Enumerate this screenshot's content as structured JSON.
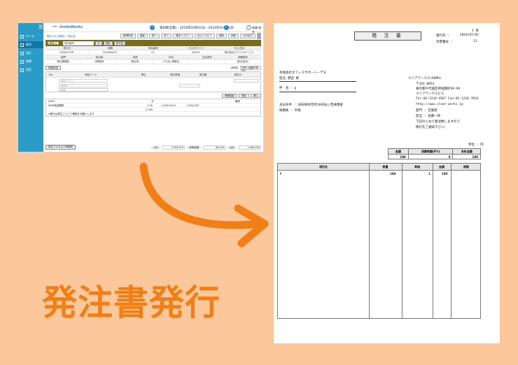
{
  "app": {
    "sidebar": {
      "items": [
        {
          "label": "ホーム",
          "icon": "home-icon"
        },
        {
          "label": "販売",
          "icon": "cart-icon"
        },
        {
          "label": "会計",
          "icon": "ledger-icon"
        },
        {
          "label": "帳簿",
          "icon": "book-icon"
        },
        {
          "label": "設定",
          "icon": "gear-icon"
        }
      ]
    },
    "topbar": {
      "logo_text": "SmileWorks",
      "period": "第8期(営業) : 2018年04月01日 - 2019年03月31日",
      "user_name": "後藤 麻衣",
      "user_button": "▼"
    },
    "breadcrumb": "販売 (仕入管理) > 発注書",
    "toolbar": [
      "新規作成",
      "複製",
      "前へ",
      "次へ",
      "発注へコピー",
      "仕入へコピー",
      "削除",
      "印刷",
      "CSV出力"
    ],
    "title": "発注書編",
    "order_no_placeholder": "発注番号",
    "order_buttons": [
      "ID",
      "検索",
      "新作成"
    ],
    "header_labels": [
      "発注日",
      "納期",
      "発注番号",
      "仕入先コード",
      "仕入先名"
    ],
    "header_values": [
      "2018/07/26",
      "2018/08/20",
      "01",
      "wh101",
      "株式会社スマイルサービス"
    ],
    "sub_labels": [
      "部門",
      "担当者",
      "状態",
      "件名",
      "支払条件",
      "納期条件"
    ],
    "sub_values": [
      "発注業務部",
      "小野裕司",
      "発注済",
      "うちまい様受注",
      "",
      "翌月(翌月)"
    ],
    "button_detail": "明細追加",
    "tax_label": "消費税",
    "tax_value": "外税 (自動計算) 8%",
    "item_head": [
      "No.",
      "商品コード",
      "単位",
      "発注単価",
      "発注額",
      "税区分"
    ],
    "item_placeholders": [
      "商品コード",
      "商品名",
      "備考",
      "備考 (下段)"
    ],
    "row_buttons": [
      "明細複製",
      "削除",
      "挿入"
    ],
    "list_rows": [
      {
        "code": "0999",
        "unit": "式",
        "price": "",
        "amount": "",
        "note": "備考"
      },
      {
        "code": "WEB商品開発",
        "unit": "1.00",
        "price": "1,000,000.0",
        "amount": "1,000,000",
        "note": ""
      },
      {
        "code": "",
        "unit": "(1.00)",
        "price": "",
        "amount": "",
        "note": ""
      },
      {
        "code": "※着日は受注ごとにて確認をお願いします",
        "unit": "",
        "price": "",
        "amount": "",
        "note": ""
      }
    ],
    "footer": {
      "button": "発注マスタより再取得",
      "subtotal_label": "小計",
      "subtotal": "1,000,000",
      "tax_label": "消費税額",
      "tax": "80,000",
      "total_label": "合計",
      "total": "1,080,000"
    }
  },
  "caption": "発注書発行",
  "document": {
    "page": "1 頁",
    "title": "発 注 書",
    "issue_label": "発行日 :",
    "issue_date": "2018/07/01",
    "number_label": "伝票番号 :",
    "number": "21",
    "to_company": "有限会社オフィスサポート・デモ",
    "to_person": "担当 菅田 様",
    "subject_label": "件　名 : p",
    "payment": "支払条件 : 20日締め翌月20日払い普通預金",
    "delivery": "納期後 : 外税",
    "from_company": "クリアワークス(DEMO)",
    "from_zip": "〒101-0054",
    "from_address1": "東京都千代田区神田錦町99-99",
    "from_address2": "クリアワークスビル",
    "from_tel": "Tel:03-1234-4567 Fax:03-1234-7654",
    "from_url": "http://www.clear-works.jp",
    "from_dept": "部門 : 営業部",
    "from_staff": "担当 : 佐藤一郎",
    "message1": "下記のとおり発注致しますので",
    "message2": "御引をご通知下さい。",
    "unit_note": "単位 : 円",
    "summary_head": [
      "金額",
      "消費税額(8%)",
      "合計金額"
    ],
    "summary_values": [
      "100",
      "0",
      "100"
    ],
    "item_head": [
      "項目名",
      "数量",
      "単価",
      "金額",
      "摘要"
    ],
    "item_row": [
      "f",
      "100",
      "1",
      "100",
      ""
    ]
  }
}
